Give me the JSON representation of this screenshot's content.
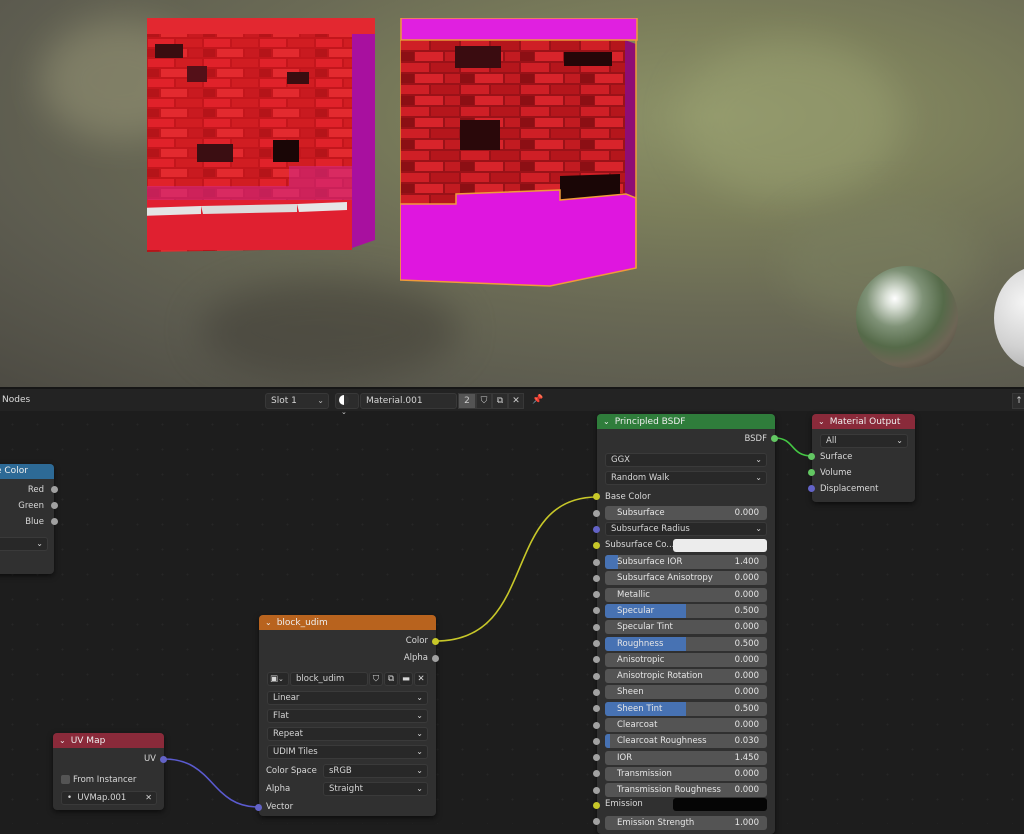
{
  "header": {
    "title": "Nodes",
    "slot": "Slot 1",
    "material": "Material.001",
    "user_count": "2"
  },
  "node_left": {
    "title": "e Color",
    "outputs": [
      "Red",
      "Green",
      "Blue"
    ]
  },
  "node_uv": {
    "title": "UV Map",
    "output": "UV",
    "from_instancer": "From Instancer",
    "uvmap": "UVMap.001"
  },
  "node_image": {
    "title": "block_udim",
    "out_color": "Color",
    "out_alpha": "Alpha",
    "image_name": "block_udim",
    "interpolation": "Linear",
    "projection": "Flat",
    "extension": "Repeat",
    "source": "UDIM Tiles",
    "color_space_label": "Color Space",
    "color_space": "sRGB",
    "alpha_label": "Alpha",
    "alpha_mode": "Straight",
    "vector": "Vector"
  },
  "node_bsdf": {
    "title": "Principled BSDF",
    "output": "BSDF",
    "distribution": "GGX",
    "subsurface_method": "Random Walk",
    "base_color": "Base Color",
    "subsurface_radius": "Subsurface Radius",
    "subsurface_color": "Subsurface Co...",
    "emission": "Emission",
    "params": [
      {
        "label": "Subsurface",
        "value": "0.000",
        "fill": 0
      },
      {
        "label": "Subsurface IOR",
        "value": "1.400",
        "fill": 0.08
      },
      {
        "label": "Subsurface Anisotropy",
        "value": "0.000",
        "fill": 0
      },
      {
        "label": "Metallic",
        "value": "0.000",
        "fill": 0
      },
      {
        "label": "Specular",
        "value": "0.500",
        "fill": 0.5
      },
      {
        "label": "Specular Tint",
        "value": "0.000",
        "fill": 0
      },
      {
        "label": "Roughness",
        "value": "0.500",
        "fill": 0.5
      },
      {
        "label": "Anisotropic",
        "value": "0.000",
        "fill": 0
      },
      {
        "label": "Anisotropic Rotation",
        "value": "0.000",
        "fill": 0
      },
      {
        "label": "Sheen",
        "value": "0.000",
        "fill": 0
      },
      {
        "label": "Sheen Tint",
        "value": "0.500",
        "fill": 0.5
      },
      {
        "label": "Clearcoat",
        "value": "0.000",
        "fill": 0
      },
      {
        "label": "Clearcoat Roughness",
        "value": "0.030",
        "fill": 0.03
      },
      {
        "label": "IOR",
        "value": "1.450",
        "fill": 0
      },
      {
        "label": "Transmission",
        "value": "0.000",
        "fill": 0
      },
      {
        "label": "Transmission Roughness",
        "value": "0.000",
        "fill": 0
      }
    ],
    "emission_strength": {
      "label": "Emission Strength",
      "value": "1.000"
    }
  },
  "node_output": {
    "title": "Material Output",
    "target": "All",
    "inputs": [
      "Surface",
      "Volume",
      "Displacement"
    ]
  },
  "colors": {
    "accent_blue": "#4772b3",
    "socket_yellow": "#c7c729",
    "socket_grey": "#a1a1a1",
    "socket_purple": "#6363c7",
    "socket_green": "#63c763",
    "header_green": "#2f7d3b",
    "header_red": "#8a2a3a",
    "header_orange": "#b8631e",
    "header_blue": "#2d6a96"
  }
}
